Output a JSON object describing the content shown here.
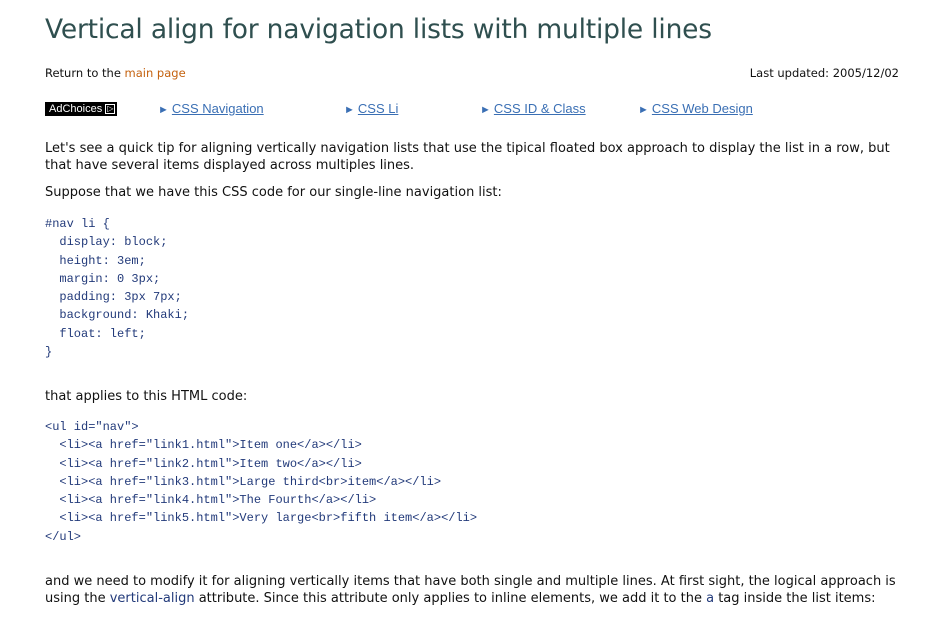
{
  "page": {
    "title": "Vertical align for navigation lists with multiple lines",
    "return_prefix": "Return to the ",
    "return_link": "main page",
    "last_updated": "Last updated: 2005/12/02"
  },
  "ads": {
    "adchoices_label": "AdChoices",
    "links": [
      {
        "arrow": "►",
        "label": "CSS Navigation"
      },
      {
        "arrow": "►",
        "label": "CSS Li"
      },
      {
        "arrow": "►",
        "label": "CSS ID & Class"
      },
      {
        "arrow": "►",
        "label": "CSS Web Design"
      }
    ]
  },
  "content": {
    "intro": "Let's see a quick tip for aligning vertically navigation lists that use the tipical floated box approach to display the list in a row, but that have several items displayed across multiples lines.",
    "suppose": "Suppose that we have this CSS code for our single-line navigation list:",
    "css_code": "#nav li {\n  display: block;\n  height: 3em;\n  margin: 0 3px;\n  padding: 3px 7px;\n  background: Khaki;\n  float: left;\n}",
    "applies": "that applies to this HTML code:",
    "html_code": "<ul id=\"nav\">\n  <li><a href=\"link1.html\">Item one</a></li>\n  <li><a href=\"link2.html\">Item two</a></li>\n  <li><a href=\"link3.html\">Large third<br>item</a></li>\n  <li><a href=\"link4.html\">The Fourth</a></li>\n  <li><a href=\"link5.html\">Very large<br>fifth item</a></li>\n</ul>",
    "modify_part1": "and we need to modify it for aligning vertically items that have both single and multiple lines. At first sight, the logical approach is using the ",
    "modify_attr": "vertical-align",
    "modify_part2": " attribute. Since this attribute only applies to inline elements, we add it to the ",
    "modify_tag": "a",
    "modify_part3": " tag inside the list items:"
  },
  "colors": {
    "title": "#2f4f4f",
    "link": "#c4620f",
    "ad_link": "#3a6fb4",
    "code": "#223a7a"
  }
}
